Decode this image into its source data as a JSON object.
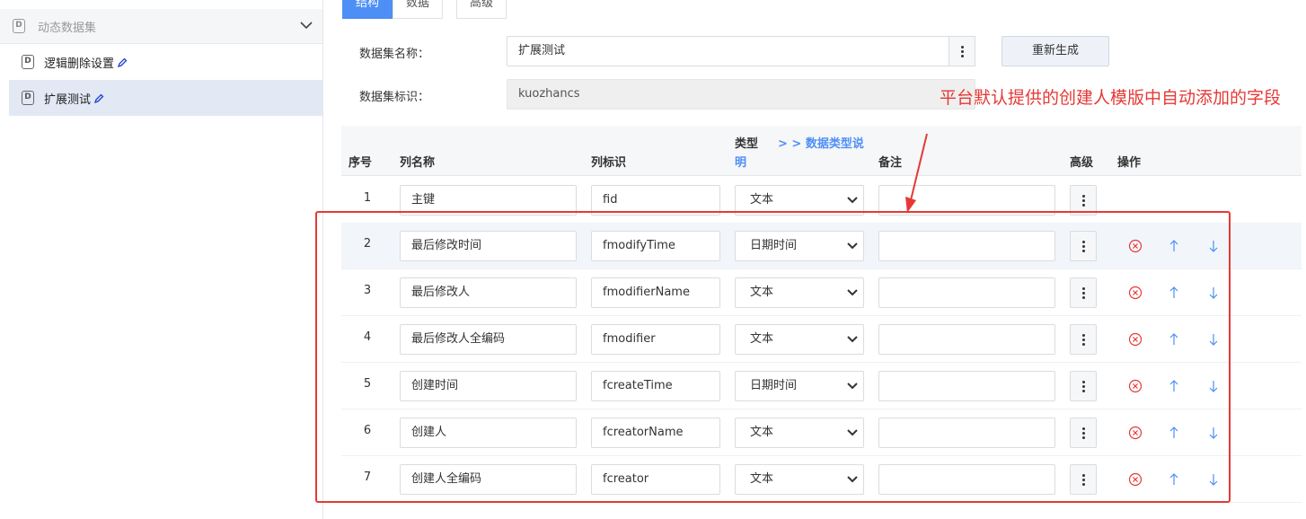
{
  "sidebar": {
    "group_title": "动态数据集",
    "items": [
      {
        "label": "逻辑删除设置",
        "active": false
      },
      {
        "label": "扩展测试",
        "active": true
      }
    ]
  },
  "tabs": [
    {
      "label": "结构",
      "active": true
    },
    {
      "label": "数据",
      "active": false
    },
    {
      "label": "高级",
      "active": false
    }
  ],
  "form": {
    "name_label": "数据集名称：",
    "name_value": "扩展测试",
    "id_label": "数据集标识：",
    "id_value": "kuozhancs",
    "regen_button": "重新生成"
  },
  "table": {
    "headers": {
      "index": "序号",
      "col_name": "列名称",
      "col_id": "列标识",
      "type": "类型",
      "type_link_1": "> > 数据类型说",
      "type_link_2": "明",
      "remark": "备注",
      "advanced": "高级",
      "ops": "操作"
    },
    "rows": [
      {
        "index": "1",
        "name": "主键",
        "id": "fid",
        "type": "文本",
        "remark": ""
      },
      {
        "index": "2",
        "name": "最后修改时间",
        "id": "fmodifyTime",
        "type": "日期时间",
        "remark": ""
      },
      {
        "index": "3",
        "name": "最后修改人",
        "id": "fmodifierName",
        "type": "文本",
        "remark": ""
      },
      {
        "index": "4",
        "name": "最后修改人全编码",
        "id": "fmodifier",
        "type": "文本",
        "remark": ""
      },
      {
        "index": "5",
        "name": "创建时间",
        "id": "fcreateTime",
        "type": "日期时间",
        "remark": ""
      },
      {
        "index": "6",
        "name": "创建人",
        "id": "fcreatorName",
        "type": "文本",
        "remark": ""
      },
      {
        "index": "7",
        "name": "创建人全编码",
        "id": "fcreator",
        "type": "文本",
        "remark": ""
      }
    ]
  },
  "annotation": {
    "text": "平台默认提供的创建人模版中自动添加的字段",
    "color": "#e53935"
  },
  "colors": {
    "accent": "#4e8ff5",
    "delete": "#e53935",
    "arrow": "#4e8ff5"
  },
  "icons": [
    "dataset-icon",
    "chevron-down-icon",
    "pencil-icon",
    "kebab-icon",
    "delete-icon",
    "arrow-up-icon",
    "arrow-down-icon",
    "select-caret-icon"
  ]
}
